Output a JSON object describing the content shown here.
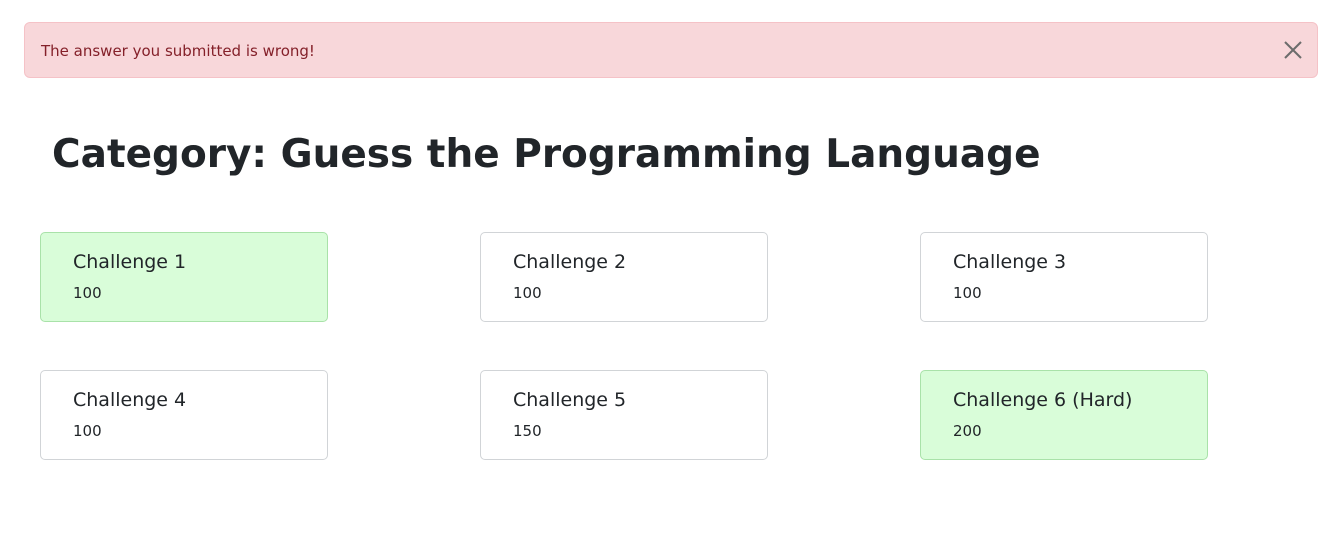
{
  "alert": {
    "message": "The answer you submitted is wrong!",
    "close_icon": "close-icon",
    "type": "danger",
    "background_color": "#f8d7da",
    "text_color": "#842029"
  },
  "page": {
    "title": "Category: Guess the Programming Language"
  },
  "challenges": [
    {
      "title": "Challenge 1",
      "points": "100",
      "solved": true
    },
    {
      "title": "Challenge 2",
      "points": "100",
      "solved": false
    },
    {
      "title": "Challenge 3",
      "points": "100",
      "solved": false
    },
    {
      "title": "Challenge 4",
      "points": "100",
      "solved": false
    },
    {
      "title": "Challenge 5",
      "points": "150",
      "solved": false
    },
    {
      "title": "Challenge 6 (Hard)",
      "points": "200",
      "solved": true
    }
  ],
  "colors": {
    "solved_background": "#d9fdd9",
    "unsolved_background": "#ffffff"
  }
}
